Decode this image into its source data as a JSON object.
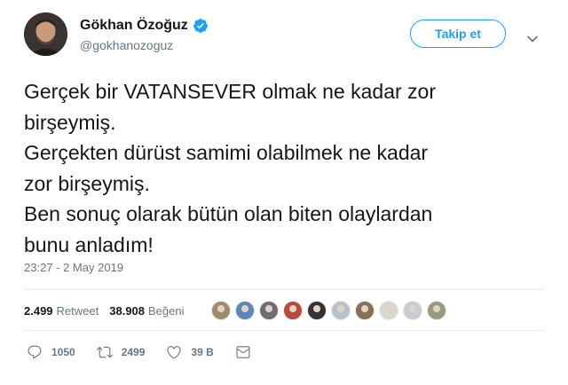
{
  "user": {
    "name": "Gökhan Özoğuz",
    "handle": "@gokhanozoguz",
    "follow_label": "Takip et"
  },
  "tweet": {
    "lines": [
      "Gerçek bir VATANSEVER olmak ne kadar zor",
      "birşeymiş.",
      "Gerçekten dürüst samimi olabilmek ne kadar",
      "zor birşeymiş.",
      "Ben sonuç olarak bütün olan biten olaylardan",
      "bunu anladım!"
    ],
    "timestamp": "23:27 - 2 May 2019"
  },
  "stats": {
    "retweets": "2.499",
    "retweets_label": "Retweet",
    "likes": "38.908",
    "likes_label": "Beğeni"
  },
  "likers": [
    {
      "icon": "liker-avatar",
      "color": "#a08a6a"
    },
    {
      "icon": "liker-avatar",
      "color": "#5b86b8"
    },
    {
      "icon": "liker-avatar",
      "color": "#6f6f6f"
    },
    {
      "icon": "liker-avatar",
      "color": "#b84a3a"
    },
    {
      "icon": "liker-avatar",
      "color": "#333333"
    },
    {
      "icon": "liker-avatar",
      "color": "#b9c2cc"
    },
    {
      "icon": "liker-avatar",
      "color": "#8a6f55"
    },
    {
      "icon": "liker-avatar",
      "color": "#d7d7d0"
    },
    {
      "icon": "liker-avatar",
      "color": "#c5ccd4"
    },
    {
      "icon": "liker-avatar",
      "color": "#9a9a80"
    }
  ],
  "actions": {
    "replies": "1050",
    "retweets": "2499",
    "likes": "39 B"
  },
  "colors": {
    "accent": "#1da1f2",
    "text": "#14171a",
    "secondary": "#657786",
    "border": "#e6ecf0"
  }
}
